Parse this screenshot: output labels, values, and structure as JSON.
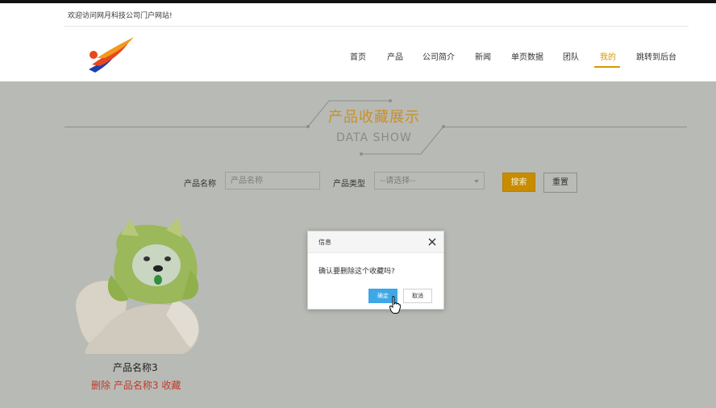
{
  "header": {
    "welcome_text": "欢迎访问网月科技公司门户网站!",
    "nav": [
      {
        "label": "首页"
      },
      {
        "label": "产品"
      },
      {
        "label": "公司简介"
      },
      {
        "label": "新闻"
      },
      {
        "label": "单页数据"
      },
      {
        "label": "团队"
      },
      {
        "label": "我的",
        "active": true
      },
      {
        "label": "跳转到后台"
      }
    ],
    "accent_color": "#d59a00"
  },
  "page": {
    "title_cn": "产品收藏展示",
    "title_en": "DATA SHOW"
  },
  "search": {
    "name_label": "产品名称",
    "name_placeholder": "产品名称",
    "type_label": "产品类型",
    "type_selected": "--请选择--",
    "search_button": "搜索",
    "reset_button": "重置"
  },
  "products": [
    {
      "name": "产品名称3",
      "delete_label": "删除",
      "fav_name": "产品名称3",
      "fav_label": "收藏",
      "image": "cabbage-dog-image"
    }
  ],
  "dialog": {
    "title": "信息",
    "message": "确认要删除这个收藏吗?",
    "ok_label": "确定",
    "cancel_label": "取消",
    "close_icon": "close-icon"
  }
}
